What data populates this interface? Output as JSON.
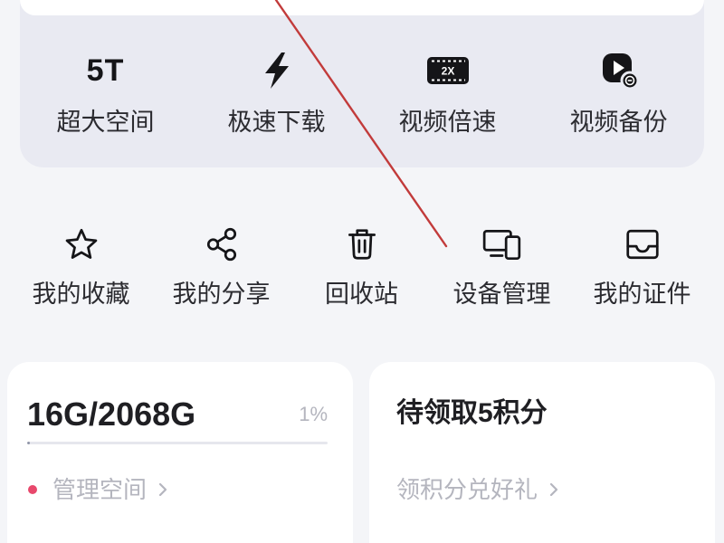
{
  "features": [
    {
      "label": "超大空间",
      "icon": "storage-5t-icon",
      "icon_text": "5T"
    },
    {
      "label": "极速下载",
      "icon": "lightning-icon"
    },
    {
      "label": "视频倍速",
      "icon": "video-speed-2x-icon",
      "icon_text": "2X"
    },
    {
      "label": "视频备份",
      "icon": "video-backup-icon"
    }
  ],
  "tools": [
    {
      "label": "我的收藏",
      "icon": "star-icon"
    },
    {
      "label": "我的分享",
      "icon": "share-icon"
    },
    {
      "label": "回收站",
      "icon": "trash-icon"
    },
    {
      "label": "设备管理",
      "icon": "devices-icon"
    },
    {
      "label": "我的证件",
      "icon": "id-card-icon"
    }
  ],
  "storage": {
    "usage": "16G/2068G",
    "percent_text": "1%",
    "progress": 0.01,
    "manage_label": "管理空间",
    "manage_icon": "chevron-right-icon"
  },
  "points": {
    "title": "待领取5积分",
    "action_label": "领积分兑好礼",
    "action_icon": "chevron-right-icon"
  },
  "colors": {
    "page_bg": "#f4f5f8",
    "feature_card_bg": "#e9eaf2",
    "card_bg": "#ffffff",
    "text_primary": "#2b2b30",
    "text_secondary": "#b4b5be",
    "accent_dot": "#e8486c",
    "annotation": "#c23b3b",
    "progress_track": "#e6e7ed",
    "progress_fill": "#8f95a8",
    "icon_ink": "#151518"
  }
}
